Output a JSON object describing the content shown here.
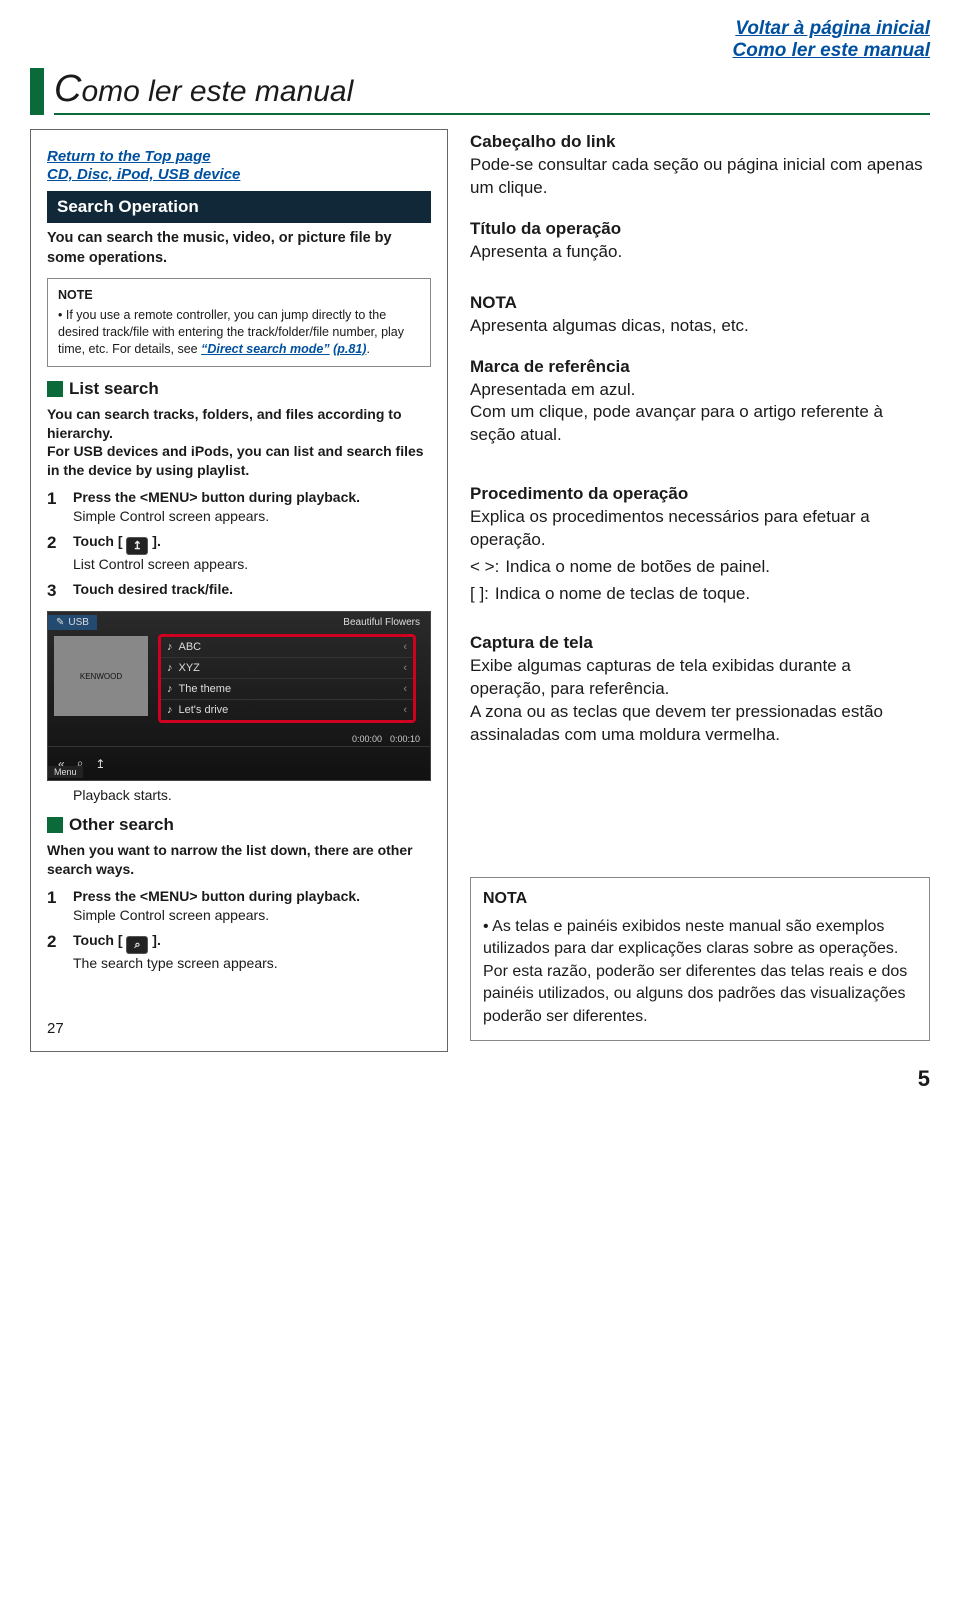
{
  "topLinks": {
    "home": "Voltar à página inicial",
    "howto": "Como ler este manual"
  },
  "pageTitle": {
    "cap": "C",
    "rest": "omo ler este manual"
  },
  "left": {
    "links": {
      "top": "Return to the Top page",
      "device": "CD, Disc, iPod, USB device"
    },
    "opBar": "Search Operation",
    "opDesc": "You can search the music, video, or picture file by some operations.",
    "note": {
      "heading": "NOTE",
      "bullet": "•",
      "textA": "If you use a remote controller, you can jump directly to the desired track/file with entering the track/folder/file number, play time, etc. For details, see ",
      "link": "Direct search mode",
      "pageRef": "(p.81)",
      "textB": "."
    },
    "listSearch": {
      "title": "List search",
      "body1": "You can search tracks, folders, and files according to hierarchy.",
      "body2": "For USB devices and iPods, you can list and search files in the device by using playlist."
    },
    "steps1": {
      "s1": {
        "num": "1",
        "bold": "Press the <MENU> button during playback.",
        "plain": "Simple Control screen appears."
      },
      "s2": {
        "num": "2",
        "boldA": "Touch [",
        "boldB": "].",
        "plain": "List Control screen appears."
      },
      "s3": {
        "num": "3",
        "bold": "Touch desired track/file."
      }
    },
    "screenshot": {
      "usbLabel": "USB",
      "fileLabel": "Beautiful Flowers",
      "art": "KENWOOD",
      "rows": [
        "ABC",
        "XYZ",
        "The theme",
        "Let's drive"
      ],
      "time1": "0:00:00",
      "time2": "0:00:10",
      "controls": {
        "back": "«",
        "search": "⌕",
        "up": "↥"
      },
      "menu": "Menu"
    },
    "afterShot": "Playback starts.",
    "otherSearch": {
      "title": "Other search",
      "body": "When you want to narrow the list down, there are other search ways."
    },
    "steps2": {
      "s1": {
        "num": "1",
        "bold": "Press the <MENU> button during playback.",
        "plain": "Simple Control screen appears."
      },
      "s2": {
        "num": "2",
        "boldA": "Touch [",
        "boldB": "].",
        "plain": "The search type screen appears."
      }
    },
    "innerPage": "27"
  },
  "right": {
    "b1": {
      "t": "Cabeçalho do link",
      "d": "Pode-se consultar cada seção ou página inicial com apenas um clique."
    },
    "b2": {
      "t": "Título da operação",
      "d": "Apresenta a função."
    },
    "b3": {
      "t": "NOTA",
      "d": "Apresenta algumas dicas, notas, etc."
    },
    "b4": {
      "t": "Marca de referência",
      "d1": "Apresentada em azul.",
      "d2": "Com um clique, pode avançar para o artigo referente à seção atual."
    },
    "b5": {
      "t": "Procedimento da operação",
      "d": "Explica os procedimentos necessários para efetuar a operação.",
      "row1sym": "<    >:",
      "row1txt": "Indica o nome de botões de painel.",
      "row2sym": "[      ]:",
      "row2txt": "Indica o nome de teclas de toque."
    },
    "b6": {
      "t": "Captura de tela",
      "d1": "Exibe algumas capturas de tela exibidas durante a operação, para referência.",
      "d2": "A zona ou as teclas que devem ter pressionadas estão assinaladas com uma moldura vermelha."
    },
    "nota": {
      "h": "NOTA",
      "li1": "As telas e painéis exibidos neste manual são exemplos utilizados para dar explicações claras sobre as operações.",
      "li2": "Por esta razão, poderão ser diferentes das telas reais e dos painéis utilizados, ou alguns dos padrões das visualizações poderão ser diferentes."
    }
  },
  "pageNumber": "5"
}
